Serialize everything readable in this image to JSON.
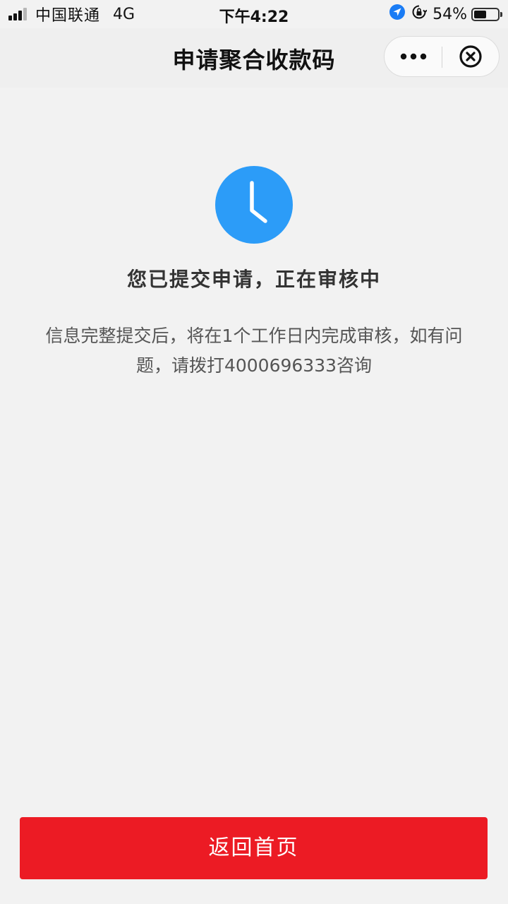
{
  "status_bar": {
    "carrier": "中国联通",
    "network": "4G",
    "time": "下午4:22",
    "battery_percent_label": "54%",
    "battery_level": 0.54,
    "icons": [
      "signal-icon",
      "location-arrow-icon",
      "orientation-lock-icon",
      "battery-icon"
    ]
  },
  "nav": {
    "title": "申请聚合收款码",
    "capsule": {
      "more_icon": "more-dots-icon",
      "close_icon": "close-circle-icon"
    }
  },
  "result": {
    "icon": "clock-icon",
    "icon_color": "#2c9cf8",
    "title": "您已提交申请，正在审核中",
    "description": "信息完整提交后，将在1个工作日内完成审核，如有问题，请拨打4000696333咨询"
  },
  "footer": {
    "home_button_label": "返回首页",
    "button_color": "#ec1b24"
  }
}
